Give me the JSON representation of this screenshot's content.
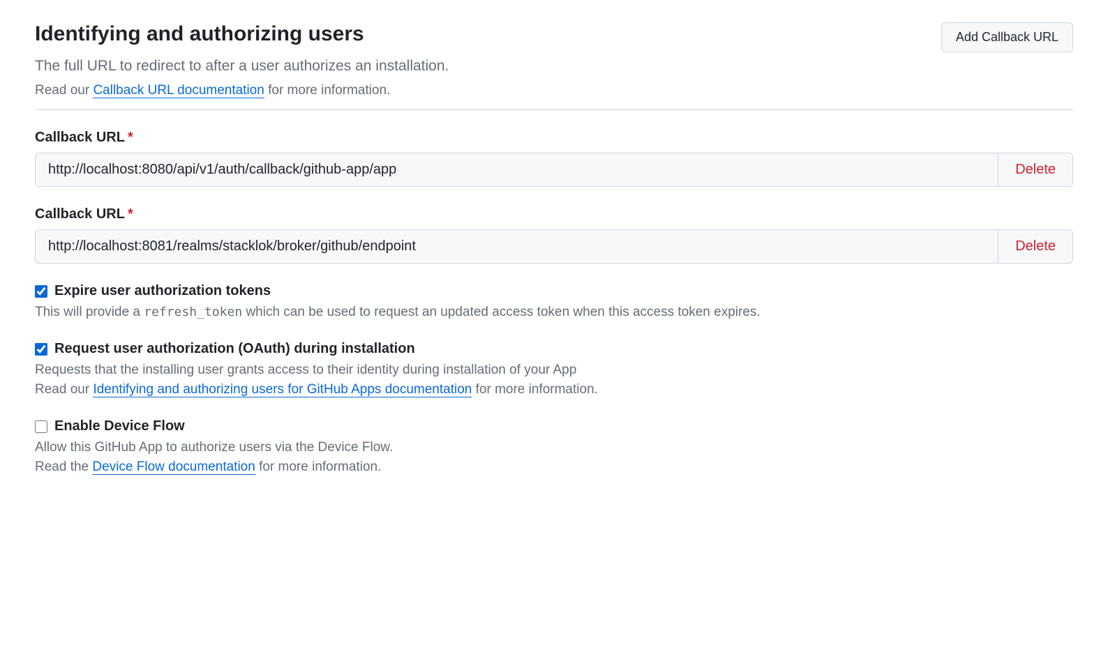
{
  "section": {
    "title": "Identifying and authorizing users",
    "subtitle": "The full URL to redirect to after a user authorizes an installation.",
    "help_prefix": "Read our ",
    "help_link_text": "Callback URL documentation",
    "help_suffix": " for more information.",
    "add_button_label": "Add Callback URL"
  },
  "callbacks": [
    {
      "label": "Callback URL",
      "required_mark": "*",
      "value": "http://localhost:8080/api/v1/auth/callback/github-app/app",
      "delete_label": "Delete"
    },
    {
      "label": "Callback URL",
      "required_mark": "*",
      "value": "http://localhost:8081/realms/stacklok/broker/github/endpoint",
      "delete_label": "Delete"
    }
  ],
  "options": {
    "expire_tokens": {
      "checked": true,
      "label": "Expire user authorization tokens",
      "desc_prefix": "This will provide a ",
      "desc_code": "refresh_token",
      "desc_suffix": " which can be used to request an updated access token when this access token expires."
    },
    "request_oauth": {
      "checked": true,
      "label": "Request user authorization (OAuth) during installation",
      "desc1": "Requests that the installing user grants access to their identity during installation of your App",
      "desc2_prefix": "Read our ",
      "desc2_link": "Identifying and authorizing users for GitHub Apps documentation",
      "desc2_suffix": " for more information."
    },
    "device_flow": {
      "checked": false,
      "label": "Enable Device Flow",
      "desc1": "Allow this GitHub App to authorize users via the Device Flow.",
      "desc2_prefix": "Read the ",
      "desc2_link": "Device Flow documentation",
      "desc2_suffix": " for more information."
    }
  }
}
